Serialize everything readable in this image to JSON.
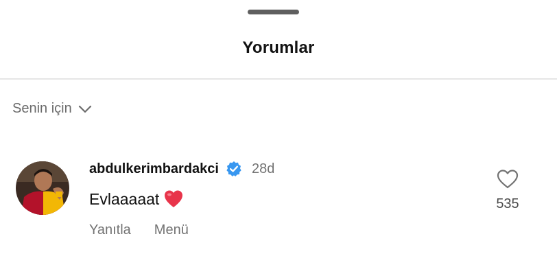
{
  "sheet": {
    "title": "Yorumlar"
  },
  "filter": {
    "label": "Senin için",
    "icon": "chevron-down-icon"
  },
  "comment": {
    "username": "abdulkerimbardakci",
    "verified": true,
    "time_ago": "28d",
    "text": "Evlaaaaat",
    "emoji": "red-heart",
    "actions": {
      "reply_label": "Yanıtla",
      "menu_label": "Menü"
    },
    "likes": "535"
  },
  "colors": {
    "verified_badge": "#3897f0",
    "heart_emoji": "#e8344a",
    "muted_text": "#737373",
    "avatar_jersey_red": "#b3122a",
    "avatar_jersey_yellow": "#f2b705"
  }
}
